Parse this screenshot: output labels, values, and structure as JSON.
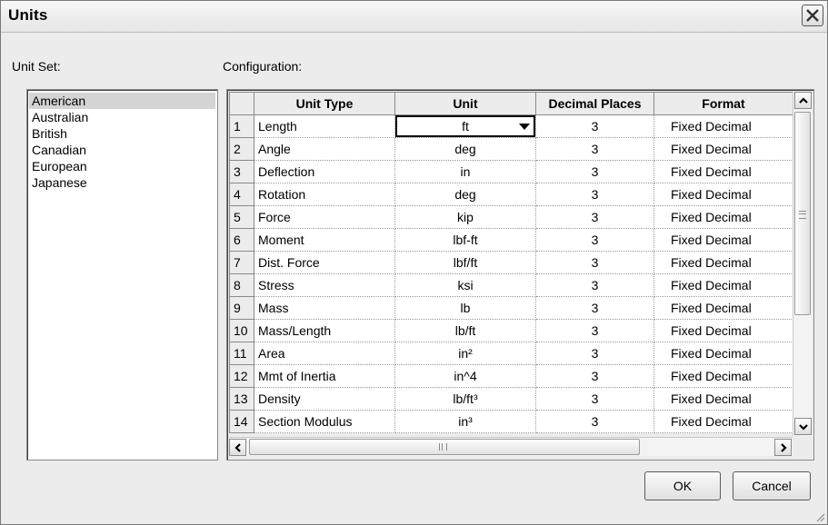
{
  "window": {
    "title": "Units"
  },
  "labels": {
    "unit_set": "Unit Set:",
    "configuration": "Configuration:"
  },
  "unit_sets": {
    "selected": "American",
    "items": [
      "American",
      "Australian",
      "British",
      "Canadian",
      "European",
      "Japanese"
    ]
  },
  "grid": {
    "headers": {
      "row": "",
      "unit_type": "Unit Type",
      "unit": "Unit",
      "decimal_places": "Decimal Places",
      "format": "Format"
    },
    "rows": [
      {
        "n": "1",
        "type": "Length",
        "unit": "ft",
        "decimals": "3",
        "format": "Fixed Decimal"
      },
      {
        "n": "2",
        "type": "Angle",
        "unit": "deg",
        "decimals": "3",
        "format": "Fixed Decimal"
      },
      {
        "n": "3",
        "type": "Deflection",
        "unit": "in",
        "decimals": "3",
        "format": "Fixed Decimal"
      },
      {
        "n": "4",
        "type": "Rotation",
        "unit": "deg",
        "decimals": "3",
        "format": "Fixed Decimal"
      },
      {
        "n": "5",
        "type": "Force",
        "unit": "kip",
        "decimals": "3",
        "format": "Fixed Decimal"
      },
      {
        "n": "6",
        "type": "Moment",
        "unit": "lbf-ft",
        "decimals": "3",
        "format": "Fixed Decimal"
      },
      {
        "n": "7",
        "type": "Dist. Force",
        "unit": "lbf/ft",
        "decimals": "3",
        "format": "Fixed Decimal"
      },
      {
        "n": "8",
        "type": "Stress",
        "unit": "ksi",
        "decimals": "3",
        "format": "Fixed Decimal"
      },
      {
        "n": "9",
        "type": "Mass",
        "unit": "lb",
        "decimals": "3",
        "format": "Fixed Decimal"
      },
      {
        "n": "10",
        "type": "Mass/Length",
        "unit": "lb/ft",
        "decimals": "3",
        "format": "Fixed Decimal"
      },
      {
        "n": "11",
        "type": "Area",
        "unit": "in²",
        "decimals": "3",
        "format": "Fixed Decimal"
      },
      {
        "n": "12",
        "type": "Mmt of Inertia",
        "unit": "in^4",
        "decimals": "3",
        "format": "Fixed Decimal"
      },
      {
        "n": "13",
        "type": "Density",
        "unit": "lb/ft³",
        "decimals": "3",
        "format": "Fixed Decimal"
      },
      {
        "n": "14",
        "type": "Section Modulus",
        "unit": "in³",
        "decimals": "3",
        "format": "Fixed Decimal"
      }
    ],
    "editing_row": 0
  },
  "buttons": {
    "ok": "OK",
    "cancel": "Cancel"
  },
  "icons": {
    "close": "close-icon",
    "scroll_up": "chevron-up-icon",
    "scroll_down": "chevron-down-icon",
    "scroll_left": "chevron-left-icon",
    "scroll_right": "chevron-right-icon",
    "dropdown": "dropdown-arrow-icon",
    "resize": "resize-grip-icon"
  }
}
